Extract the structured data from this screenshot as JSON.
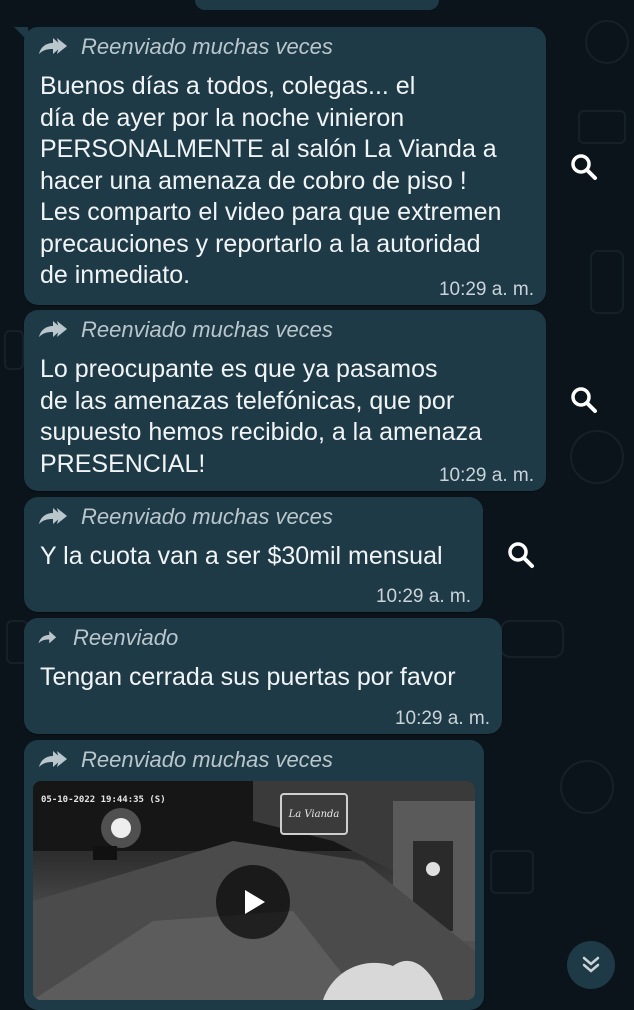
{
  "messages": [
    {
      "forward_label": "Reenviado muchas veces",
      "forward_icon": "double-forward-arrow-icon",
      "text": "Buenos días a todos, colegas... el\ndía de ayer por la noche vinieron\nPERSONALMENTE al salón La Vianda a\nhacer una amenaza de cobro de piso !\nLes comparto el video para que extremen\nprecauciones y reportarlo a la autoridad\nde inmediato.",
      "time": "10:29 a. m."
    },
    {
      "forward_label": "Reenviado muchas veces",
      "forward_icon": "double-forward-arrow-icon",
      "text": "Lo preocupante es que ya pasamos\nde las amenazas telefónicas, que por\nsupuesto hemos recibido, a la amenaza\nPRESENCIAL!",
      "time": "10:29 a. m."
    },
    {
      "forward_label": "Reenviado muchas veces",
      "forward_icon": "double-forward-arrow-icon",
      "text": "Y la cuota van a ser $30mil mensual",
      "time": "10:29 a. m."
    },
    {
      "forward_label": "Reenviado",
      "forward_icon": "forward-arrow-icon",
      "text": "Tengan cerrada sus puertas por favor",
      "time": "10:29 a. m."
    },
    {
      "forward_label": "Reenviado muchas veces",
      "forward_icon": "double-forward-arrow-icon",
      "video": {
        "timestamp_overlay": "05-10-2022 19:44:35 (S)",
        "sign_text": "La Vianda",
        "play_icon": "play-icon"
      }
    }
  ],
  "colors": {
    "background": "#0b141a",
    "bubble": "#1f3a47",
    "text": "#f1f4f5"
  },
  "icons": {
    "search": "search-icon",
    "scroll_down": "chevron-double-down-icon"
  }
}
